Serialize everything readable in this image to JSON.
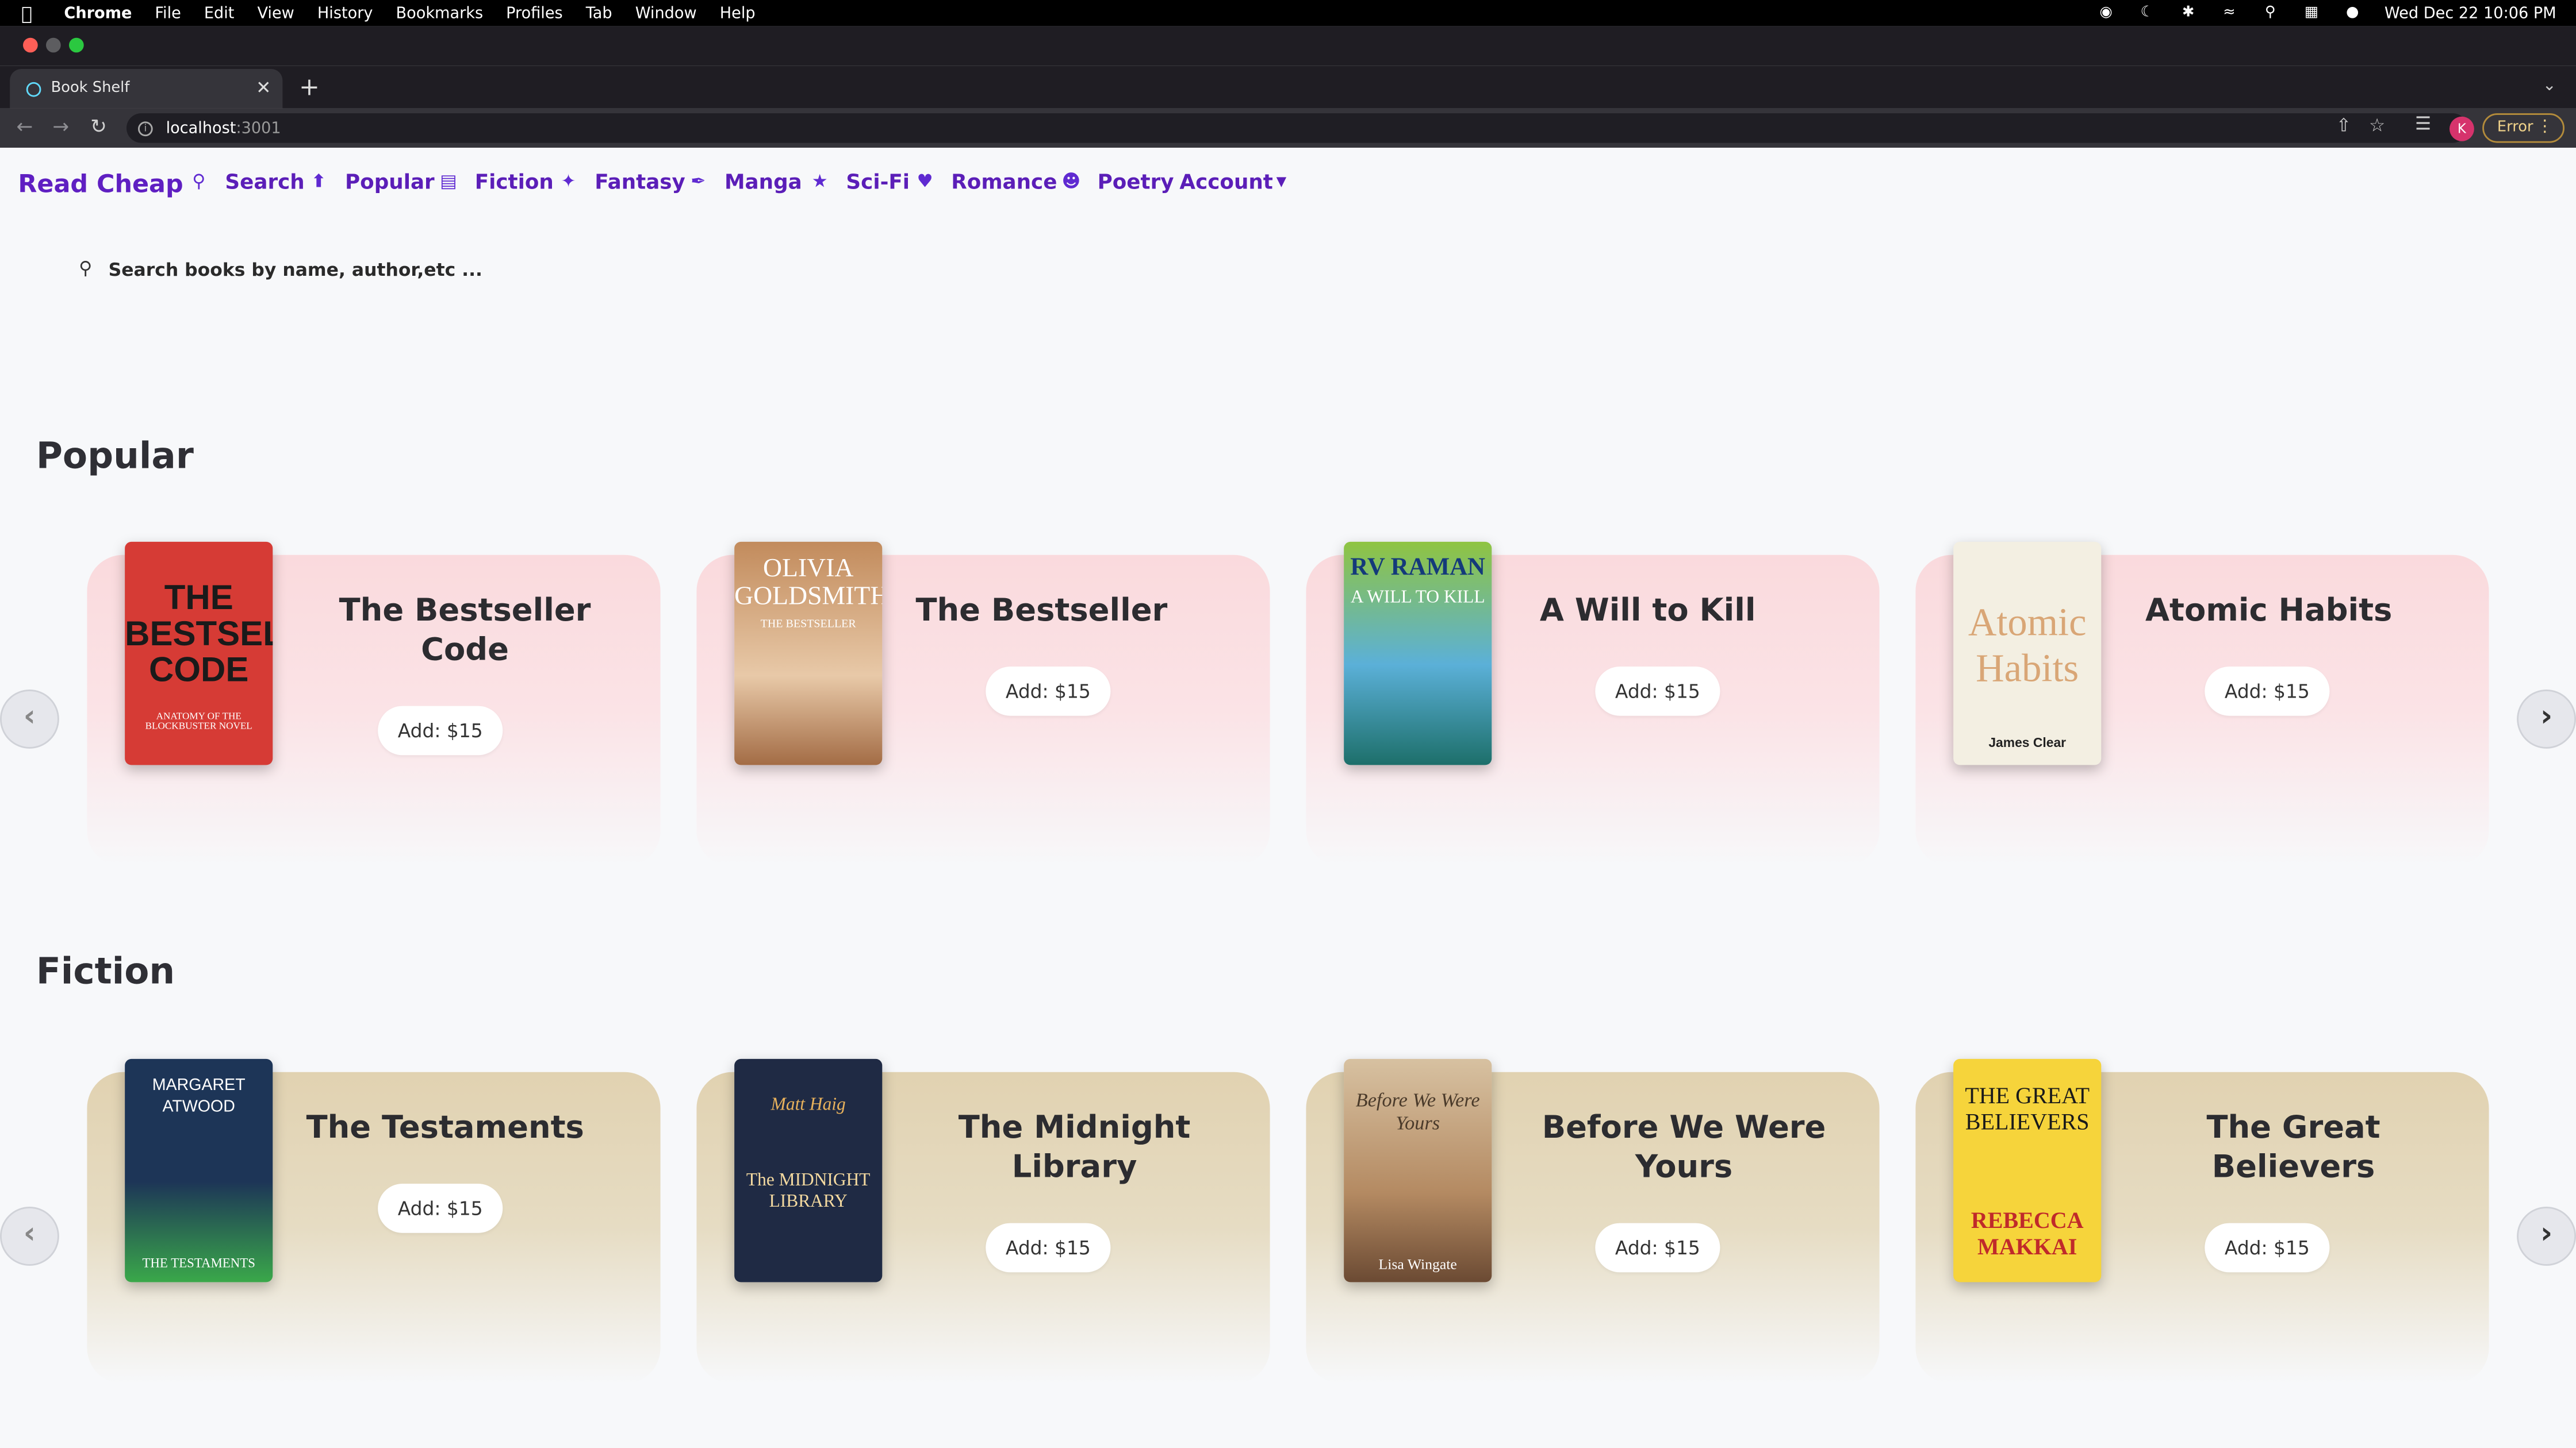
{
  "menubar": {
    "app": "Chrome",
    "items": [
      "File",
      "Edit",
      "View",
      "History",
      "Bookmarks",
      "Profiles",
      "Tab",
      "Window",
      "Help"
    ],
    "datetime": "Wed Dec 22  10:06 PM"
  },
  "browser": {
    "tab_title": "Book Shelf",
    "url_host": "localhost",
    "url_port": ":3001",
    "profile_initial": "K",
    "error_label": "Error"
  },
  "app": {
    "brand": "Read Cheap",
    "nav": [
      {
        "label": "Search",
        "icon": "search-icon"
      },
      {
        "label": "Popular",
        "icon": "arrow-up-circle-icon"
      },
      {
        "label": "Fiction",
        "icon": "book-icon"
      },
      {
        "label": "Fantasy",
        "icon": "wizard-icon"
      },
      {
        "label": "Manga",
        "icon": "pen-icon"
      },
      {
        "label": "Sci-Fi",
        "icon": "astronaut-icon"
      },
      {
        "label": "Romance",
        "icon": "heart-icon"
      },
      {
        "label": "Poetry",
        "icon": "smile-icon"
      }
    ],
    "account_label": "Account",
    "search_placeholder": "Search books by name, author,etc ...",
    "sections": [
      {
        "title": "Popular",
        "books": [
          {
            "title": "The Bestseller Code",
            "price": "Add: $15",
            "cover": "THE BESTSELLER CODE",
            "cover_sub": "ANATOMY OF THE BLOCKBUSTER NOVEL"
          },
          {
            "title": "The Bestseller",
            "price": "Add: $15",
            "cover": "OLIVIA GOLDSMITH",
            "cover_sub": "THE BESTSELLER"
          },
          {
            "title": "A Will to Kill",
            "price": "Add: $15",
            "cover": "RV RAMAN",
            "cover_sub": "A WILL TO KILL"
          },
          {
            "title": "Atomic Habits",
            "price": "Add: $15",
            "cover": "Atomic Habits",
            "cover_sub": "James Clear"
          }
        ]
      },
      {
        "title": "Fiction",
        "books": [
          {
            "title": "The Testaments",
            "price": "Add: $15",
            "cover": "MARGARET ATWOOD",
            "cover_sub": "THE TESTAMENTS"
          },
          {
            "title": "The Midnight Library",
            "price": "Add: $15",
            "cover": "Matt Haig",
            "cover_sub": "The MIDNIGHT LIBRARY"
          },
          {
            "title": "Before We Were Yours",
            "price": "Add: $15",
            "cover": "Before We Were Yours",
            "cover_sub": "Lisa Wingate"
          },
          {
            "title": "The Great Believers",
            "price": "Add: $15",
            "cover": "THE GREAT BELIEVERS",
            "cover_sub": "REBECCA MAKKAI"
          }
        ]
      }
    ]
  }
}
